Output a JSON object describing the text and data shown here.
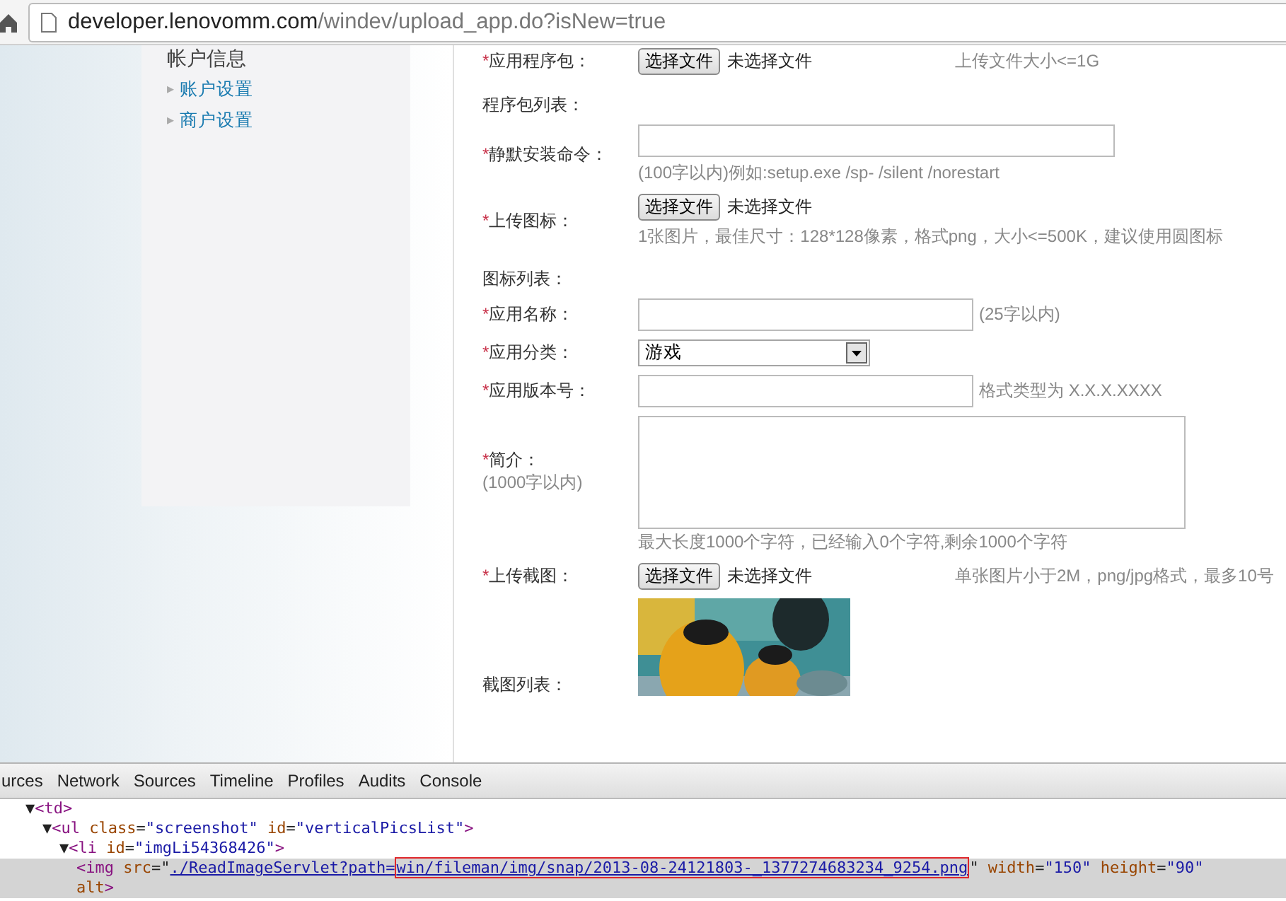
{
  "address_bar": {
    "host": "developer.lenovomm.com",
    "path": "/windev/upload_app.do?isNew=true"
  },
  "sidebar": {
    "title": "帐户信息",
    "items": [
      {
        "marker": "▸",
        "label": "账户设置"
      },
      {
        "marker": "▸",
        "label": "商户设置"
      }
    ]
  },
  "form": {
    "rows": [
      {
        "kind": "file",
        "marker": "*",
        "label": "应用程序包：",
        "button": "选择文件",
        "status": "未选择文件",
        "hint": "上传文件大小<=1G"
      },
      {
        "kind": "list",
        "label": "程序包列表："
      },
      {
        "kind": "input",
        "marker": "*",
        "label": "静默安装命令：",
        "value": "",
        "hint_below": "(100字以内)例如:setup.exe /sp- /silent /norestart"
      },
      {
        "kind": "file",
        "marker": "*",
        "label": "上传图标：",
        "button": "选择文件",
        "status": "未选择文件",
        "hint_below": "1张图片，最佳尺寸：128*128像素，格式png，大小<=500K，建议使用圆图标"
      },
      {
        "kind": "list",
        "label": "图标列表："
      },
      {
        "kind": "input",
        "marker": "*",
        "label": "应用名称：",
        "value": "",
        "hint": "(25字以内)"
      },
      {
        "kind": "select",
        "marker": "*",
        "label": "应用分类：",
        "value": "游戏"
      },
      {
        "kind": "input",
        "marker": "*",
        "label": "应用版本号：",
        "value": "",
        "hint": "格式类型为 X.X.X.XXXX"
      },
      {
        "kind": "textarea",
        "marker": "*",
        "label": "简介：",
        "sublabel": "(1000字以内)",
        "value": "",
        "hint_below": "最大长度1000个字符，已经输入0个字符,剩余1000个字符"
      },
      {
        "kind": "file",
        "marker": "*",
        "label": "上传截图：",
        "button": "选择文件",
        "status": "未选择文件",
        "hint": "单张图片小于2M，png/jpg格式，最多10号"
      },
      {
        "kind": "gallery",
        "label": "截图列表："
      }
    ]
  },
  "devtools": {
    "tabs": [
      "urces",
      "Network",
      "Sources",
      "Timeline",
      "Profiles",
      "Audits",
      "Console"
    ],
    "dom_tree": [
      {
        "toggle": "▼",
        "selected": false,
        "tokens": [
          {
            "kind": "tag",
            "text": "<td>"
          }
        ],
        "children": [
          {
            "toggle": "▼",
            "selected": false,
            "tokens": [
              {
                "kind": "tag",
                "text": "<ul"
              },
              {
                "kind": "attr",
                "text": " class"
              },
              {
                "kind": "punct",
                "text": "="
              },
              {
                "kind": "value",
                "text": "\"screenshot\""
              },
              {
                "kind": "attr",
                "text": " id"
              },
              {
                "kind": "punct",
                "text": "="
              },
              {
                "kind": "value",
                "text": "\"verticalPicsList\""
              },
              {
                "kind": "tag",
                "text": ">"
              }
            ],
            "children": [
              {
                "toggle": "▼",
                "selected": false,
                "tokens": [
                  {
                    "kind": "tag",
                    "text": "<li"
                  },
                  {
                    "kind": "attr",
                    "text": " id"
                  },
                  {
                    "kind": "punct",
                    "text": "="
                  },
                  {
                    "kind": "value",
                    "text": "\"imgLi54368426\""
                  },
                  {
                    "kind": "tag",
                    "text": ">"
                  }
                ],
                "children": [
                  {
                    "selected": true,
                    "tokens": [
                      {
                        "kind": "tag",
                        "text": "<img"
                      },
                      {
                        "kind": "attr",
                        "text": " src"
                      },
                      {
                        "kind": "punct",
                        "text": "=\""
                      },
                      {
                        "kind": "link",
                        "text": "./ReadImageServlet?path=",
                        "boxed": false
                      },
                      {
                        "kind": "link",
                        "text": "win/fileman/img/snap/2013-08-24121803-_1377274683234_9254.png",
                        "boxed": true
                      },
                      {
                        "kind": "punct",
                        "text": "\""
                      },
                      {
                        "kind": "attr",
                        "text": " width"
                      },
                      {
                        "kind": "punct",
                        "text": "="
                      },
                      {
                        "kind": "value",
                        "text": "\"150\""
                      },
                      {
                        "kind": "attr",
                        "text": " height"
                      },
                      {
                        "kind": "punct",
                        "text": "="
                      },
                      {
                        "kind": "value",
                        "text": "\"90\""
                      }
                    ],
                    "continuation": [
                      {
                        "kind": "attr",
                        "text": "alt"
                      },
                      {
                        "kind": "tag",
                        "text": ">"
                      }
                    ]
                  }
                ]
              }
            ]
          }
        ]
      }
    ]
  }
}
